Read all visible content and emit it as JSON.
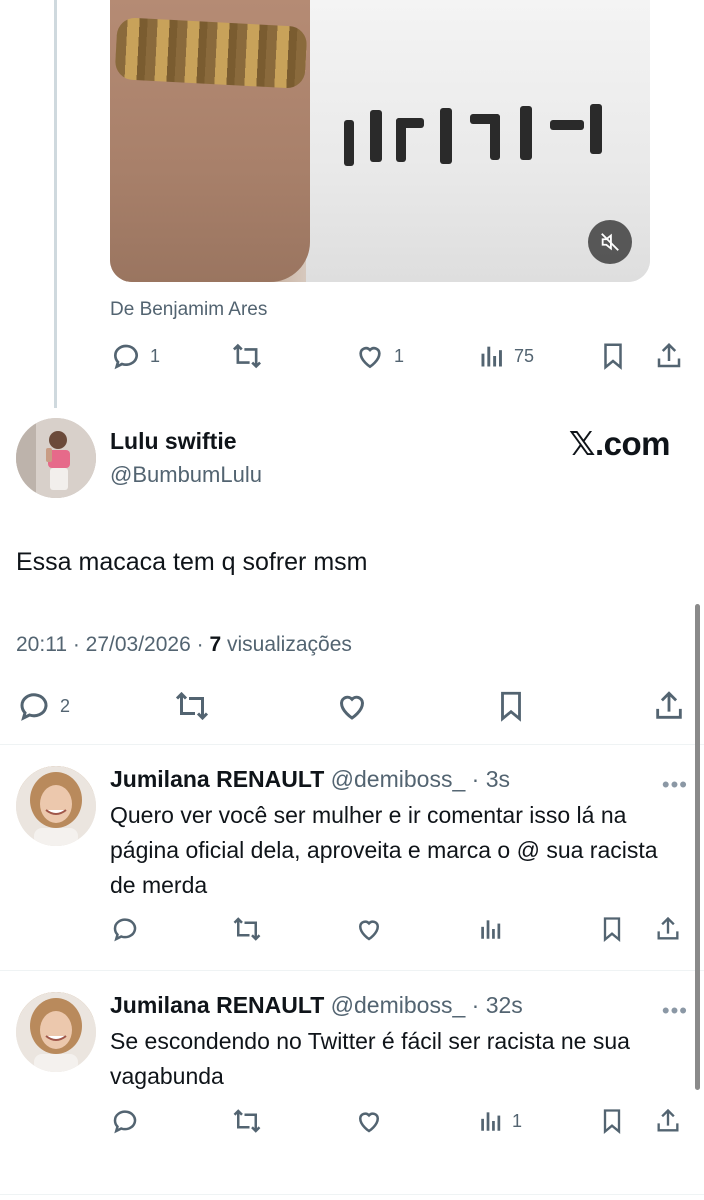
{
  "quoted_media": {
    "source": "De Benjamim Ares",
    "mute_icon": "speaker-muted-icon"
  },
  "quoted_actions": {
    "replies": "1",
    "retweets": "",
    "likes": "1",
    "views": "75"
  },
  "tweet": {
    "author_name": "Lulu swiftie",
    "author_handle": "@BumbumLulu",
    "watermark": "𝕏.com",
    "text": "Essa macaca tem q sofrer msm",
    "time": "20:11",
    "date": "27/03/2026",
    "views_count": "7",
    "views_label": "visualizações",
    "replies": "2"
  },
  "replies": [
    {
      "name": "Jumilana RENAULT",
      "handle": "@demiboss_",
      "time": "3s",
      "text": "Quero ver você ser mulher e ir comentar isso lá na página oficial dela, aproveita e marca o @ sua racista de merda",
      "views": ""
    },
    {
      "name": "Jumilana RENAULT",
      "handle": "@demiboss_",
      "time": "32s",
      "text": "Se escondendo no Twitter é fácil ser racista ne sua vagabunda",
      "views": "1"
    }
  ],
  "colors": {
    "text": "#0f1419",
    "secondary": "#536471",
    "divider": "#eff3f4"
  }
}
